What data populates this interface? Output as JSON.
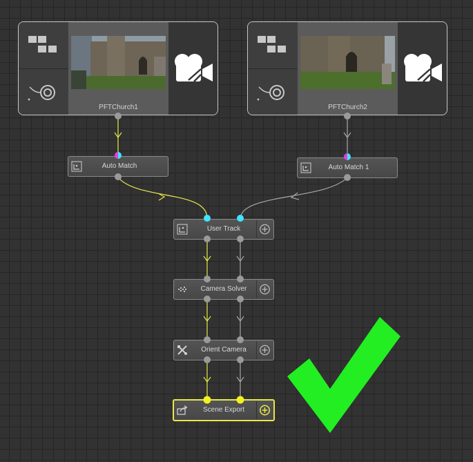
{
  "clips": [
    {
      "name": "PFTChurch1"
    },
    {
      "name": "PFTChurch2"
    }
  ],
  "nodes": {
    "auto_match": "Auto Match",
    "auto_match_1": "Auto Match 1",
    "user_track": "User Track",
    "camera_solver": "Camera Solver",
    "orient_camera": "Orient Camera",
    "scene_export": "Scene Export"
  },
  "colors": {
    "canvas": "#323232",
    "wire_primary": "#e8e84a",
    "wire_secondary": "#a8a8a8",
    "selected_border": "#e8e84a",
    "port_cyan": "#3fe4ff",
    "port_magenta": "#e040e0",
    "checkmark": "#22ee22"
  },
  "icons": {
    "clip_tiles": "tiles-icon",
    "clip_lens": "lens-icon",
    "clip_camera": "movie-camera-icon",
    "add": "plus-circle-icon",
    "checkmark": "checkmark-icon"
  }
}
